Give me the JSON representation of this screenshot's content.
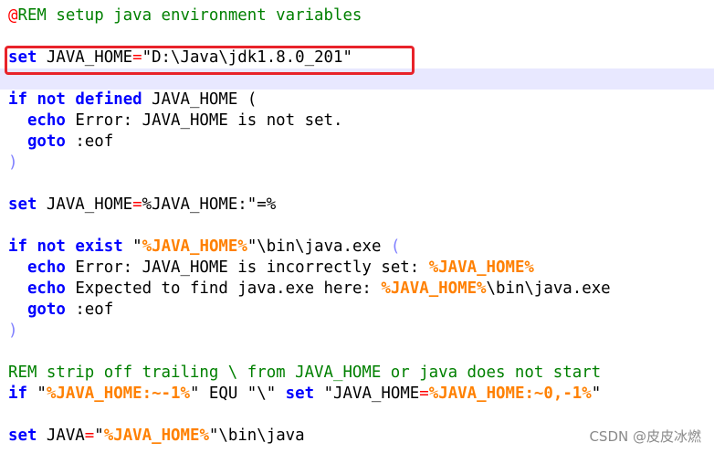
{
  "editor": {
    "lines": [
      [
        {
          "t": "@",
          "c": "at"
        },
        {
          "t": "REM setup java environment variables",
          "c": "comment"
        }
      ],
      [],
      [
        {
          "t": "set",
          "c": "kw"
        },
        {
          "t": " JAVA_HOME",
          "c": "plain"
        },
        {
          "t": "=",
          "c": "op"
        },
        {
          "t": "\"D:\\Java\\jdk1.8.0_201\"",
          "c": "plain"
        }
      ],
      [],
      [
        {
          "t": "if",
          "c": "kw"
        },
        {
          "t": " ",
          "c": "plain"
        },
        {
          "t": "not",
          "c": "kw"
        },
        {
          "t": " ",
          "c": "plain"
        },
        {
          "t": "defined",
          "c": "kw"
        },
        {
          "t": " JAVA_HOME ",
          "c": "plain"
        },
        {
          "t": "(",
          "c": "plain"
        }
      ],
      [
        {
          "t": "  ",
          "c": "plain"
        },
        {
          "t": "echo",
          "c": "kw"
        },
        {
          "t": " Error: JAVA_HOME is not set.",
          "c": "plain"
        }
      ],
      [
        {
          "t": "  ",
          "c": "plain"
        },
        {
          "t": "goto",
          "c": "kw"
        },
        {
          "t": " :eof",
          "c": "plain"
        }
      ],
      [
        {
          "t": ")",
          "c": "paren"
        }
      ],
      [],
      [
        {
          "t": "set",
          "c": "kw"
        },
        {
          "t": " JAVA_HOME",
          "c": "plain"
        },
        {
          "t": "=",
          "c": "op"
        },
        {
          "t": "%JAVA_HOME:\"=%",
          "c": "plain"
        }
      ],
      [],
      [
        {
          "t": "if",
          "c": "kw"
        },
        {
          "t": " ",
          "c": "plain"
        },
        {
          "t": "not",
          "c": "kw"
        },
        {
          "t": " ",
          "c": "plain"
        },
        {
          "t": "exist",
          "c": "kw"
        },
        {
          "t": " \"",
          "c": "plain"
        },
        {
          "t": "%JAVA_HOME%",
          "c": "var"
        },
        {
          "t": "\"\\bin\\java.exe ",
          "c": "plain"
        },
        {
          "t": "(",
          "c": "paren"
        }
      ],
      [
        {
          "t": "  ",
          "c": "plain"
        },
        {
          "t": "echo",
          "c": "kw"
        },
        {
          "t": " Error: JAVA_HOME is incorrectly set: ",
          "c": "plain"
        },
        {
          "t": "%JAVA_HOME%",
          "c": "var"
        }
      ],
      [
        {
          "t": "  ",
          "c": "plain"
        },
        {
          "t": "echo",
          "c": "kw"
        },
        {
          "t": " Expected to find java.exe here: ",
          "c": "plain"
        },
        {
          "t": "%JAVA_HOME%",
          "c": "var"
        },
        {
          "t": "\\bin\\java.exe",
          "c": "plain"
        }
      ],
      [
        {
          "t": "  ",
          "c": "plain"
        },
        {
          "t": "goto",
          "c": "kw"
        },
        {
          "t": " :eof",
          "c": "plain"
        }
      ],
      [
        {
          "t": ")",
          "c": "paren"
        }
      ],
      [],
      [
        {
          "t": "REM strip off trailing \\ from JAVA_HOME or java does not start",
          "c": "comment"
        }
      ],
      [
        {
          "t": "if",
          "c": "kw"
        },
        {
          "t": " \"",
          "c": "plain"
        },
        {
          "t": "%JAVA_HOME:~-1%",
          "c": "var"
        },
        {
          "t": "\" EQU \"\\\" ",
          "c": "plain"
        },
        {
          "t": "set",
          "c": "kw"
        },
        {
          "t": " \"JAVA_HOME",
          "c": "plain"
        },
        {
          "t": "=",
          "c": "op"
        },
        {
          "t": "%JAVA_HOME:~0,-1%",
          "c": "var"
        },
        {
          "t": "\"",
          "c": "plain"
        }
      ],
      [],
      [
        {
          "t": "set",
          "c": "kw"
        },
        {
          "t": " JAVA",
          "c": "plain"
        },
        {
          "t": "=",
          "c": "op"
        },
        {
          "t": "\"",
          "c": "plain"
        },
        {
          "t": "%JAVA_HOME%",
          "c": "var"
        },
        {
          "t": "\"\\bin\\java",
          "c": "plain"
        }
      ]
    ],
    "colors": {
      "keyword": "#0000ff",
      "comment": "#008000",
      "variable": "#ff8000",
      "operator": "#ff0000",
      "paren": "#8080ff",
      "text": "#000000",
      "current_line": "#e8e8ff",
      "annotation_box": "#e8232a"
    }
  },
  "watermark": "CSDN @皮皮冰燃"
}
